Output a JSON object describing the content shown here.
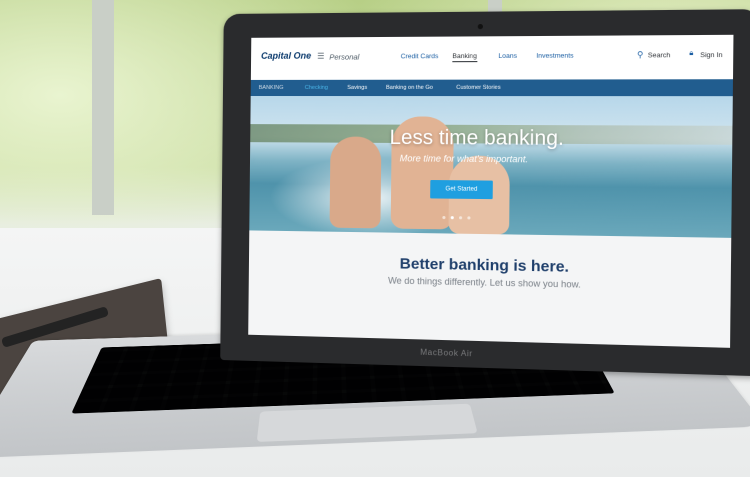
{
  "site": {
    "brand": "Capital One",
    "menu_label": "Personal",
    "nav": [
      "Credit Cards",
      "Banking",
      "Loans",
      "Investments"
    ],
    "active_nav": "Banking",
    "search_label": "Search",
    "signin_label": "Sign In"
  },
  "subnav": {
    "section": "BANKING",
    "items": [
      "Checking",
      "Savings",
      "Banking on the Go",
      "Customer Stories"
    ]
  },
  "hero": {
    "title": "Less time banking.",
    "subtitle": "More time for what's important.",
    "cta": "Get Started",
    "carousel_pages": 4,
    "carousel_active": 2
  },
  "promo": {
    "title": "Better banking is here.",
    "subtitle": "We do things differently. Let us show you how."
  },
  "device": {
    "model_label": "MacBook Air"
  },
  "colors": {
    "brand_navy": "#0b3a6d",
    "subnav_blue": "#215d8f",
    "cta_blue": "#1f9fe0",
    "link_blue": "#1a5ea3"
  },
  "icons": [
    "menu-icon",
    "search-icon",
    "lock-icon"
  ]
}
